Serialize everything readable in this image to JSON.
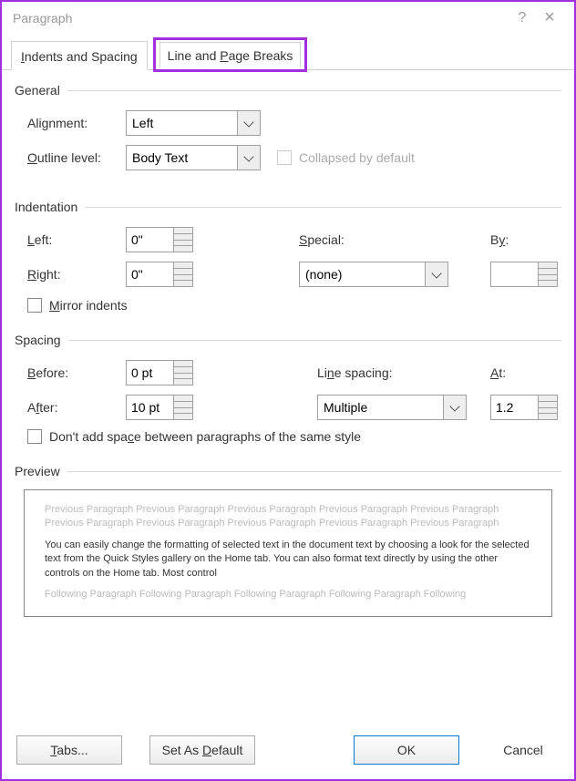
{
  "title": "Paragraph",
  "help_glyph": "?",
  "close_glyph": "×",
  "tabs": {
    "indents": "Indents and Spacing",
    "breaks": "Line and Page Breaks"
  },
  "general": {
    "title": "General",
    "alignment_label": "Alignment:",
    "alignment_value": "Left",
    "outline_label": "Outline level:",
    "outline_value": "Body Text",
    "collapsed_label": "Collapsed by default"
  },
  "indent": {
    "title": "Indentation",
    "left_label": "Left:",
    "left_value": "0\"",
    "right_label": "Right:",
    "right_value": "0\"",
    "special_label": "Special:",
    "special_value": "(none)",
    "by_label": "By:",
    "by_value": "",
    "mirror_label": "Mirror indents"
  },
  "spacing": {
    "title": "Spacing",
    "before_label": "Before:",
    "before_value": "0 pt",
    "after_label": "After:",
    "after_value": "10 pt",
    "line_label": "Line spacing:",
    "line_value": "Multiple",
    "at_label": "At:",
    "at_value": "1.2",
    "no_space_label": "Don't add space between paragraphs of the same style"
  },
  "preview": {
    "title": "Preview",
    "prev": "Previous Paragraph Previous Paragraph Previous Paragraph Previous Paragraph Previous Paragraph Previous Paragraph Previous Paragraph Previous Paragraph Previous Paragraph Previous Paragraph",
    "main": "You can easily change the formatting of selected text in the document text by choosing a look for the selected text from the Quick Styles gallery on the Home tab. You can also format text directly by using the other controls on the Home tab. Most control",
    "next": "Following Paragraph Following Paragraph Following Paragraph Following Paragraph Following"
  },
  "footer": {
    "tabs": "Tabs...",
    "default": "Set As Default",
    "ok": "OK",
    "cancel": "Cancel"
  }
}
